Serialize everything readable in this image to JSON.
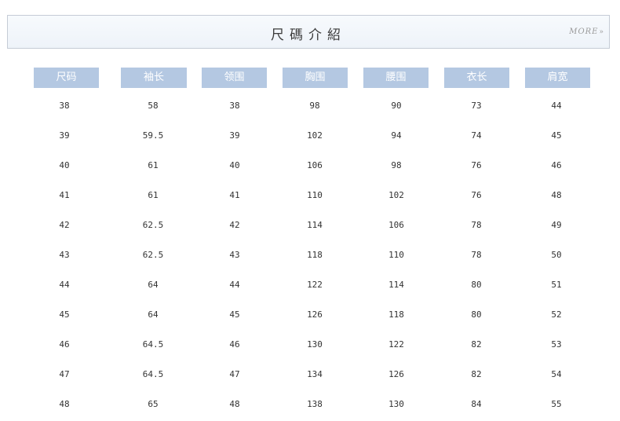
{
  "header": {
    "title": "尺碼介紹",
    "more_label": "MORE",
    "more_icon": "double-chevron-down"
  },
  "table": {
    "columns": [
      "尺码",
      "袖长",
      "领围",
      "胸围",
      "腰围",
      "衣长",
      "肩宽"
    ],
    "rows": [
      [
        "38",
        "58",
        "38",
        "98",
        "90",
        "73",
        "44"
      ],
      [
        "39",
        "59.5",
        "39",
        "102",
        "94",
        "74",
        "45"
      ],
      [
        "40",
        "61",
        "40",
        "106",
        "98",
        "76",
        "46"
      ],
      [
        "41",
        "61",
        "41",
        "110",
        "102",
        "76",
        "48"
      ],
      [
        "42",
        "62.5",
        "42",
        "114",
        "106",
        "78",
        "49"
      ],
      [
        "43",
        "62.5",
        "43",
        "118",
        "110",
        "78",
        "50"
      ],
      [
        "44",
        "64",
        "44",
        "122",
        "114",
        "80",
        "51"
      ],
      [
        "45",
        "64",
        "45",
        "126",
        "118",
        "80",
        "52"
      ],
      [
        "46",
        "64.5",
        "46",
        "130",
        "122",
        "82",
        "53"
      ],
      [
        "47",
        "64.5",
        "47",
        "134",
        "126",
        "82",
        "54"
      ],
      [
        "48",
        "65",
        "48",
        "138",
        "130",
        "84",
        "55"
      ]
    ]
  },
  "colors": {
    "header_bg": "#b4c8e2",
    "title_bar_border": "#c5ccd6"
  }
}
